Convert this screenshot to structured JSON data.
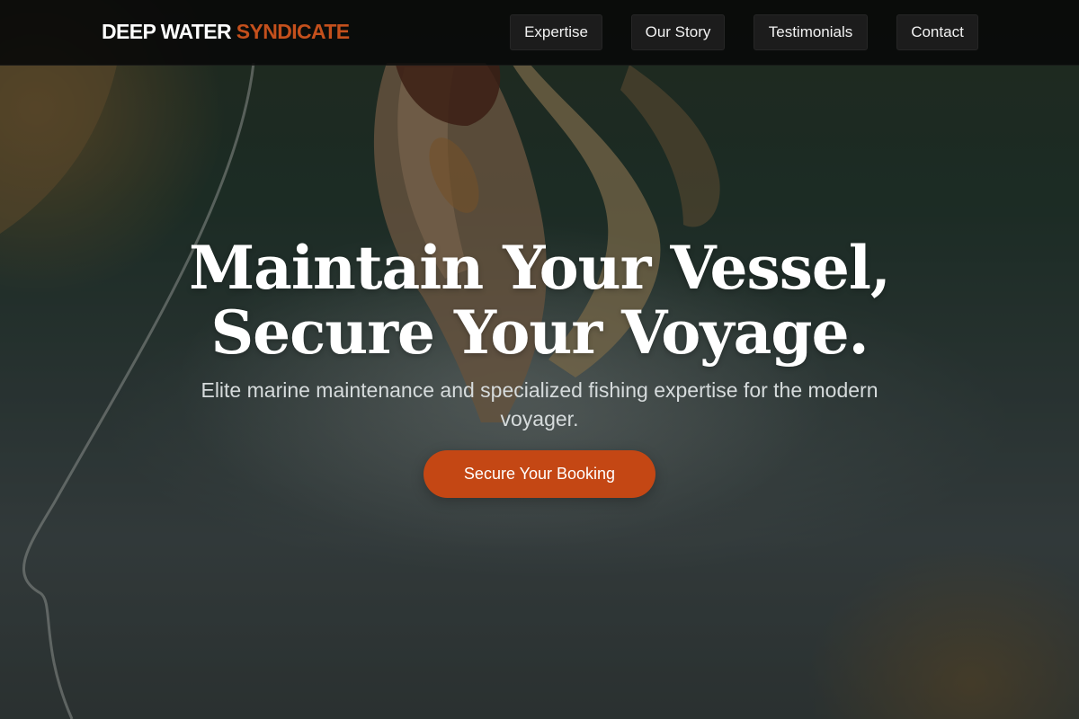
{
  "nav": {
    "brand_primary": "DEEP WATER",
    "brand_accent": "SYNDICATE",
    "items": [
      {
        "label": "Expertise"
      },
      {
        "label": "Our Story"
      },
      {
        "label": "Testimonials"
      },
      {
        "label": "Contact"
      }
    ]
  },
  "hero": {
    "title_line1": "Maintain Your Vessel,",
    "title_line2": "Secure Your Voyage.",
    "subtitle": "Elite marine maintenance and specialized fishing expertise for the modern voyager.",
    "cta_label": "Secure Your Booking",
    "background_image": "fish-on-line-photo"
  },
  "colors": {
    "accent": "#c44714",
    "brand_accent": "#c4501c",
    "nav_background": "#080808",
    "nav_button": "#1c1c1c"
  }
}
